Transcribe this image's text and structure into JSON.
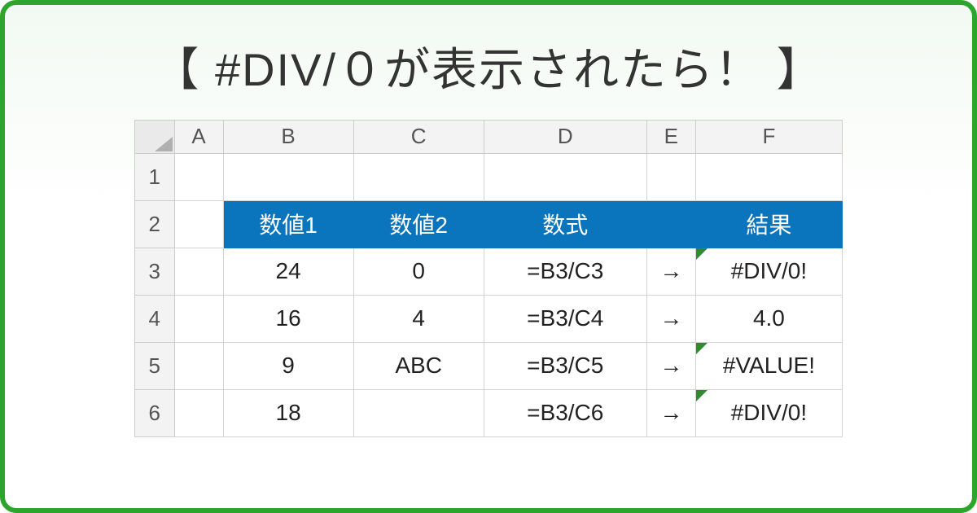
{
  "title": "【 #DIV/０が表示されたら！ 】",
  "columns": [
    "A",
    "B",
    "C",
    "D",
    "E",
    "F"
  ],
  "row_numbers": [
    "1",
    "2",
    "3",
    "4",
    "5",
    "6"
  ],
  "data_headers": {
    "B": "数値1",
    "C": "数値2",
    "D": "数式",
    "F": "結果"
  },
  "rows": [
    {
      "B": "24",
      "C": "0",
      "D": "=B3/C3",
      "E": "→",
      "F": "#DIV/0!",
      "F_err": true
    },
    {
      "B": "16",
      "C": "4",
      "D": "=B3/C4",
      "E": "→",
      "F": "4.0",
      "F_err": false
    },
    {
      "B": "9",
      "C": "ABC",
      "D": "=B3/C5",
      "E": "→",
      "F": "#VALUE!",
      "F_err": true
    },
    {
      "B": "18",
      "C": "",
      "D": "=B3/C6",
      "E": "→",
      "F": "#DIV/0!",
      "F_err": true
    }
  ]
}
